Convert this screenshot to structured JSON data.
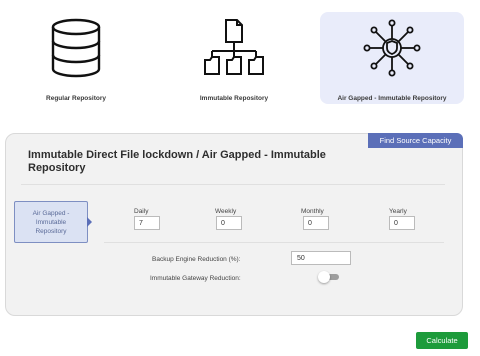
{
  "repositories": {
    "regular": {
      "label": "Regular Repository",
      "icon": "database-icon"
    },
    "immutable": {
      "label": "Immutable Repository",
      "icon": "folder-hierarchy-icon"
    },
    "airgap": {
      "label": "Air Gapped - Immutable Repository",
      "icon": "shield-network-icon",
      "selected": true
    }
  },
  "panel": {
    "title": "Immutable Direct File lockdown / Air Gapped - Immutable Repository",
    "find_button": "Find Source Capacity",
    "side_tab": "Air Gapped - Immutable Repository",
    "retention": [
      {
        "label": "Daily",
        "value": "7"
      },
      {
        "label": "Weekly",
        "value": "0"
      },
      {
        "label": "Monthly",
        "value": "0"
      },
      {
        "label": "Yearly",
        "value": "0"
      }
    ],
    "backup_reduction_label": "Backup Engine Reduction (%):",
    "backup_reduction_value": "50",
    "gateway_reduction_label": "Immutable Gateway Reduction:",
    "gateway_reduction_enabled": false
  },
  "actions": {
    "calculate": "Calculate"
  },
  "colors": {
    "accent": "#5b6fb8",
    "selected_card": "#e9ecfa",
    "calculate": "#1d9b3b"
  }
}
